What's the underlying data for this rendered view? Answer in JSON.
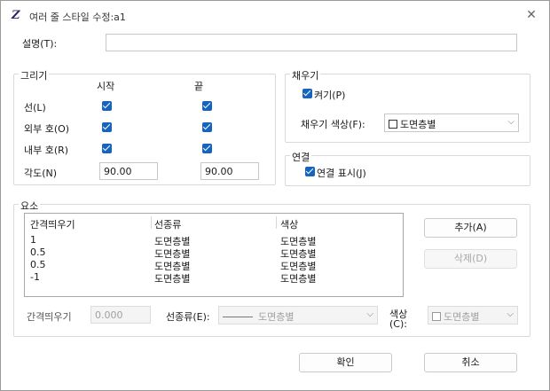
{
  "window": {
    "title": "여러 줄 스타일 수정:a1",
    "close_glyph": "✕"
  },
  "description": {
    "label": "설명(T):",
    "value": ""
  },
  "caps": {
    "group_title": "그리기",
    "col_start": "시작",
    "col_end": "끝",
    "rows": [
      {
        "label": "선(L)",
        "start": true,
        "end": true
      },
      {
        "label": "외부 호(O)",
        "start": true,
        "end": true
      },
      {
        "label": "내부 호(R)",
        "start": true,
        "end": true
      }
    ],
    "angle_label": "각도(N)",
    "angle_start": "90.00",
    "angle_end": "90.00"
  },
  "fill": {
    "group_title": "채우기",
    "on_label": "켜기(P)",
    "on_checked": true,
    "color_label": "채우기 색상(F):",
    "color_value": "도면층별"
  },
  "joints": {
    "group_title": "연결",
    "display_label": "연결 표시(J)",
    "display_checked": true
  },
  "elements": {
    "group_title": "요소",
    "headers": [
      "간격띄우기",
      "선종류",
      "색상"
    ],
    "rows": [
      [
        "1",
        "도면층별",
        "도면층별"
      ],
      [
        "0.5",
        "도면층별",
        "도면층별"
      ],
      [
        "0.5",
        "도면층별",
        "도면층별"
      ],
      [
        "-1",
        "도면층별",
        "도면층별"
      ]
    ],
    "add_button": "추가(A)",
    "delete_button": "삭제(D)",
    "offset_label": "간격띄우기",
    "offset_value": "0.000",
    "linetype_label": "선종류(E):",
    "linetype_value": "도면층별",
    "color_label": "색상(C):",
    "color_value": "도면층별"
  },
  "footer": {
    "ok_button": "확인",
    "cancel_button": "취소"
  },
  "colors": {
    "checkbox_accent": "#1565c0",
    "border": "#d9d9d9",
    "disabled_text": "#a0a0a0"
  },
  "icons": {
    "app": "autocad-z-icon",
    "close": "close-icon",
    "dropdown": "chevron-down-icon",
    "checkbox": "checkmark-icon"
  }
}
